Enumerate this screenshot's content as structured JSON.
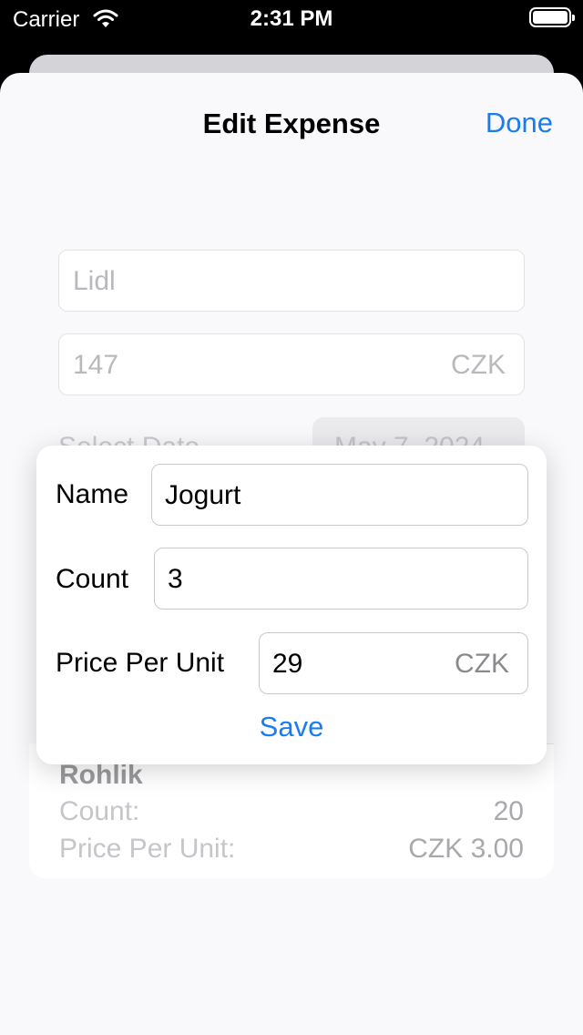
{
  "status_bar": {
    "carrier": "Carrier",
    "time": "2:31 PM"
  },
  "nav": {
    "title": "Edit Expense",
    "done_label": "Done"
  },
  "form": {
    "store_value": "Lidl",
    "amount_value": "147",
    "amount_currency": "CZK",
    "date_label": "Select Date",
    "date_value": "May 7, 2024"
  },
  "items": [
    {
      "name": "Rohlik",
      "count_label": "Count:",
      "count_value": "20",
      "price_label": "Price Per Unit:",
      "price_value": "CZK 3.00"
    }
  ],
  "popover": {
    "name_label": "Name",
    "name_value": "Jogurt",
    "count_label": "Count",
    "count_value": "3",
    "price_label": "Price Per Unit",
    "price_value": "29",
    "price_currency": "CZK",
    "save_label": "Save"
  },
  "colors": {
    "accent": "#1a7cf2",
    "sheet_background": "#f9f9fb"
  }
}
